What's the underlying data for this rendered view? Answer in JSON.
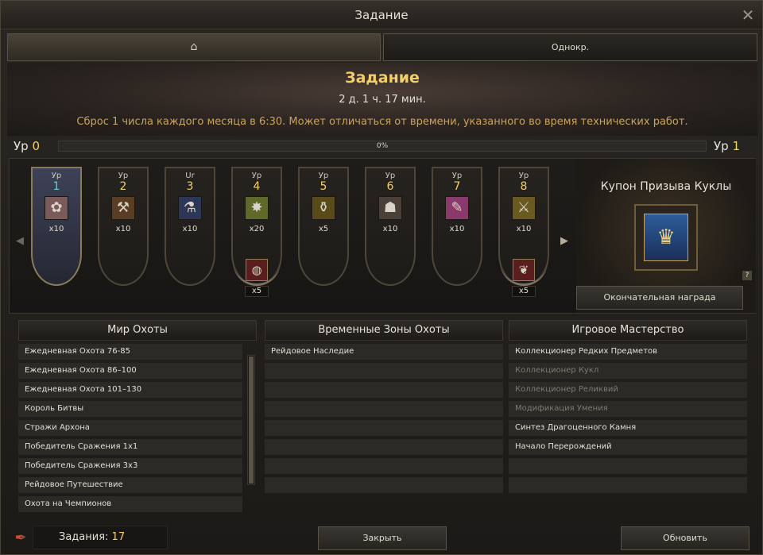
{
  "window": {
    "title": "Задание"
  },
  "tabs": [
    {
      "icon": "home-icon",
      "glyph": "⌂"
    },
    {
      "label": "Однокр."
    }
  ],
  "banner": {
    "title": "Задание",
    "time_left": "2 д. 1 ч. 17 мин.",
    "reset_note": "Сброс 1 числа каждого месяца в 6:30. Может отличаться от времени, указанного во время технических работ."
  },
  "level": {
    "label": "Ур",
    "current": "0",
    "next": "1",
    "progress_text": "0%",
    "progress_value": 0
  },
  "slots": [
    {
      "ur": "Ур",
      "level": "1",
      "qty": "x10",
      "icon": "rose-icon",
      "glyph": "✿",
      "bg": "#7a5a5a"
    },
    {
      "ur": "Ур",
      "level": "2",
      "qty": "x10",
      "icon": "scroll-icon",
      "glyph": "⚒",
      "bg": "#5a3e24"
    },
    {
      "ur": "Ur",
      "level": "3",
      "qty": "x10",
      "icon": "potion-icon",
      "glyph": "⚗",
      "bg": "#2c3656"
    },
    {
      "ur": "Ур",
      "level": "4",
      "qty": "x20",
      "icon": "crystal-icon",
      "glyph": "✸",
      "bg": "#5f6a2a"
    },
    {
      "ur": "Ур",
      "level": "5",
      "qty": "x5",
      "icon": "elixir-icon",
      "glyph": "⚱",
      "bg": "#5a4a1a"
    },
    {
      "ur": "Ур",
      "level": "6",
      "qty": "x10",
      "icon": "mask-icon",
      "glyph": "☗",
      "bg": "#4a4038"
    },
    {
      "ur": "Ур",
      "level": "7",
      "qty": "x10",
      "icon": "ticket-icon",
      "glyph": "✎",
      "bg": "#8a3a6a"
    },
    {
      "ur": "Ур",
      "level": "8",
      "qty": "x10",
      "icon": "weapon-icon",
      "glyph": "⚔",
      "bg": "#6a5a22"
    }
  ],
  "bonuses": [
    {
      "slot": 4,
      "qty": "x5",
      "icon": "egg-icon",
      "glyph": "◍"
    },
    {
      "slot": 8,
      "qty": "x5",
      "icon": "feather-icon",
      "glyph": "❦"
    }
  ],
  "final_reward": {
    "title": "Купон Призыва Куклы",
    "icon": "doll-coupon-icon",
    "glyph": "♛",
    "help": "?",
    "button": "Окончательная награда"
  },
  "columns": [
    {
      "header": "Мир Охоты",
      "quests": [
        {
          "label": "Ежедневная Охота 76-85",
          "dim": false
        },
        {
          "label": "Ежедневная Охота 86–100",
          "dim": false
        },
        {
          "label": "Ежедневная Охота 101–130",
          "dim": false
        },
        {
          "label": "Король Битвы",
          "dim": false
        },
        {
          "label": "Стражи Архона",
          "dim": false
        },
        {
          "label": "Победитель Сражения 1х1",
          "dim": false
        },
        {
          "label": "Победитель Сражения 3х3",
          "dim": false
        },
        {
          "label": "Рейдовое Путешествие",
          "dim": false
        },
        {
          "label": "Охота на Чемпионов",
          "dim": false
        }
      ]
    },
    {
      "header": "Временные Зоны Охоты",
      "quests": [
        {
          "label": "Рейдовое Наследие",
          "dim": false
        },
        {
          "label": "",
          "dim": false
        },
        {
          "label": "",
          "dim": false
        },
        {
          "label": "",
          "dim": false
        },
        {
          "label": "",
          "dim": false
        },
        {
          "label": "",
          "dim": false
        },
        {
          "label": "",
          "dim": false
        },
        {
          "label": "",
          "dim": false
        }
      ]
    },
    {
      "header": "Игровое Мастерство",
      "quests": [
        {
          "label": "Коллекционер Редких Предметов",
          "dim": false
        },
        {
          "label": "Коллекционер Кукл",
          "dim": true
        },
        {
          "label": "Коллекционер Реликвий",
          "dim": true
        },
        {
          "label": "Модификация Умения",
          "dim": true
        },
        {
          "label": "Синтез Драгоценного Камня",
          "dim": false
        },
        {
          "label": "Начало Перерождений",
          "dim": false
        },
        {
          "label": "",
          "dim": false
        },
        {
          "label": "",
          "dim": false
        }
      ]
    }
  ],
  "footer": {
    "quests_label": "Задания:",
    "quests_count": "17",
    "close_label": "Закрыть",
    "refresh_label": "Обновить"
  }
}
